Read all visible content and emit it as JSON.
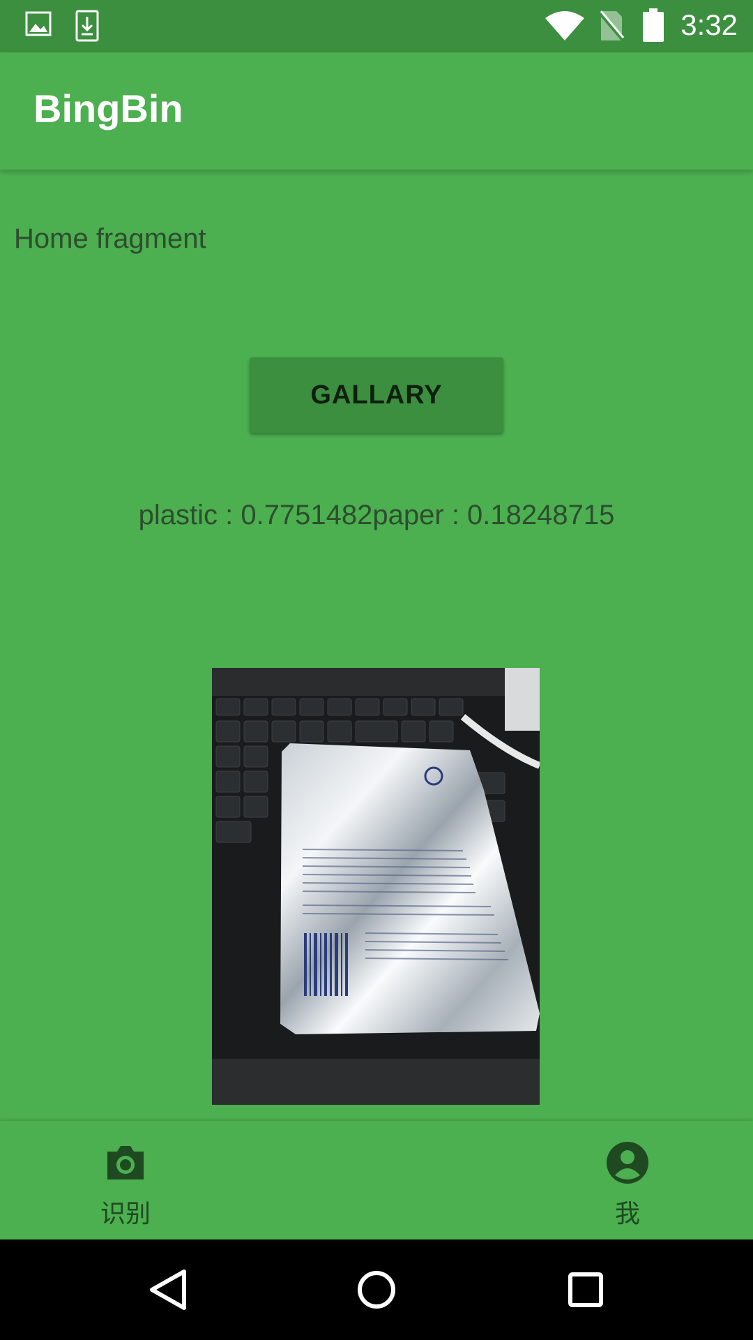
{
  "status_bar": {
    "time": "3:32",
    "icons": [
      "image-icon",
      "download-icon",
      "wifi-icon",
      "no-sim-icon",
      "battery-icon"
    ]
  },
  "app_bar": {
    "title": "BingBin"
  },
  "content": {
    "fragment_label": "Home fragment",
    "gallery_button_label": "GALLARY",
    "result_text": "plastic : 0.7751482paper : 0.18248715"
  },
  "bottom_nav": {
    "items": [
      {
        "label": "识别",
        "icon": "camera-icon"
      },
      {
        "label": "我",
        "icon": "account-icon"
      }
    ]
  },
  "system_nav": {
    "buttons": [
      "back-icon",
      "home-icon",
      "recents-icon"
    ]
  },
  "colors": {
    "status_bar": "#3b8f3f",
    "primary": "#4caf50",
    "button": "#3b8f3f",
    "text_dark": "#2e4d2f",
    "nav_icon": "#1f4a21"
  }
}
